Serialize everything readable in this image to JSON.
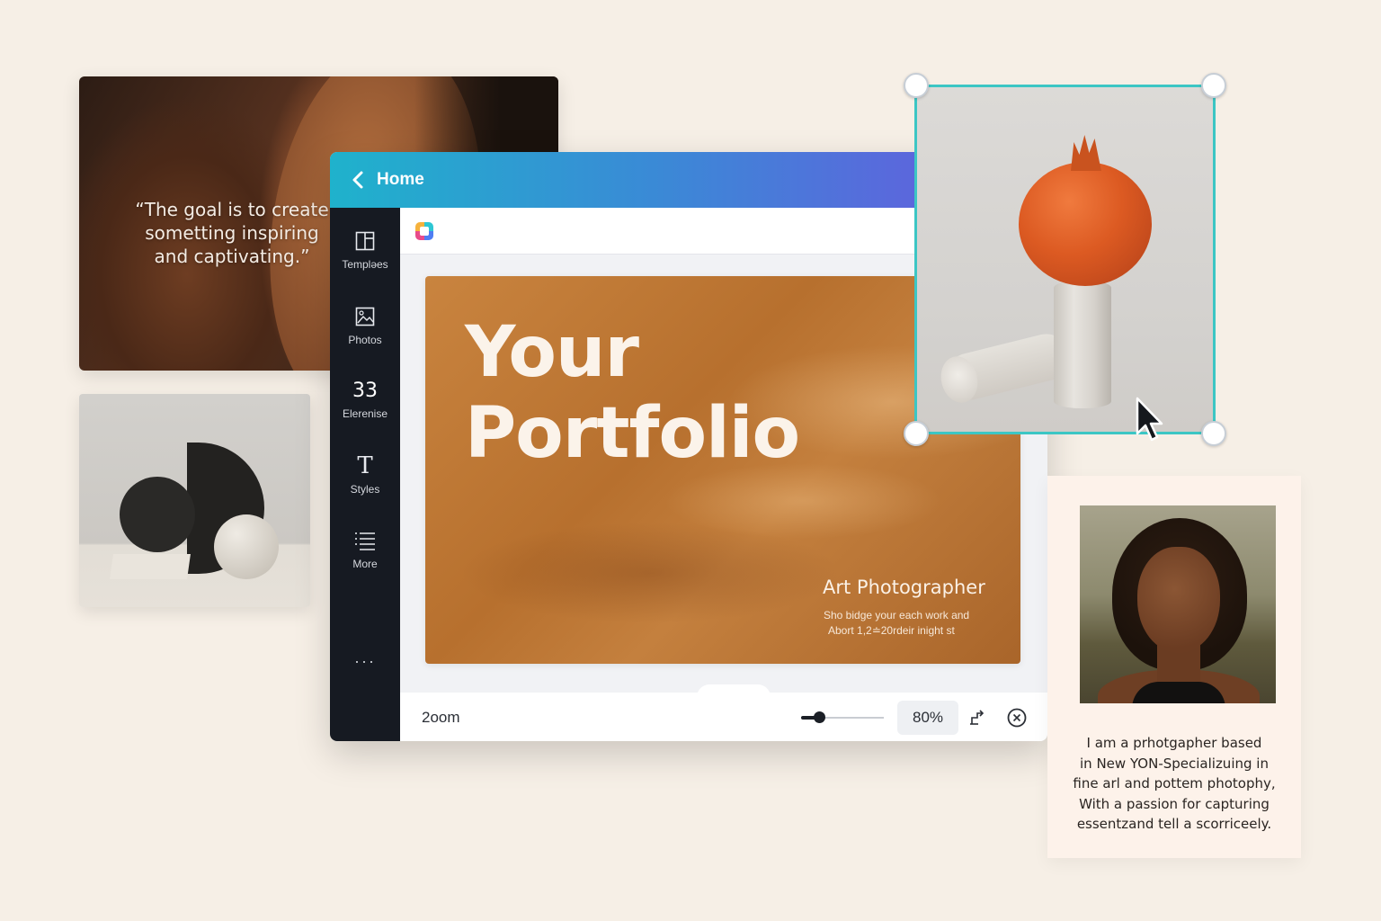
{
  "quote_card": {
    "lines": [
      "“The goal is to create",
      "sometting inspiring",
      "and captivating.”"
    ]
  },
  "editor": {
    "header": {
      "title": "Home",
      "back_icon": "chevron-left-icon"
    },
    "rail": {
      "items": [
        {
          "label": "Templəes",
          "icon": "template-icon"
        },
        {
          "label": "Photos",
          "icon": "photo-icon"
        },
        {
          "label": "Elerenise",
          "number": "33"
        },
        {
          "label": "Styles",
          "icon": "text-t-icon",
          "glyph": "T"
        },
        {
          "label": "More",
          "icon": "list-icon"
        }
      ],
      "dots": "···"
    },
    "slide": {
      "title_line1": "Your",
      "title_line2": "Portfolio",
      "role": "Art Photographer",
      "desc_line1": "Sho bidge your each work and",
      "desc_line2": "Abort 1,2≐20rdeir inight  st"
    },
    "bottom_bar": {
      "zoom_label": "2oom",
      "zoom_value": "80%",
      "zoom_level": 0.22
    }
  },
  "bio_card": {
    "lines": [
      "I am a prhotgapher based",
      "in New YON-Specializuing in",
      "fine arl and pottem photophy,",
      "With a passion for capturing",
      "essentzand tell a scorriceely."
    ]
  },
  "colors": {
    "background": "#f6efe6",
    "header_gradient_start": "#1fb2cc",
    "header_gradient_end": "#6c55e0",
    "rail": "#161a22",
    "selection": "#3cc6c4",
    "slide": "#c17a37"
  }
}
